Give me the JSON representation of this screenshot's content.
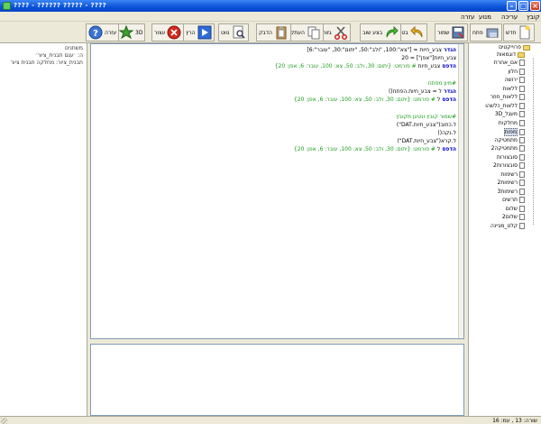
{
  "window": {
    "title": "???? - ?????? ????? - ????"
  },
  "menu": [
    "קובץ",
    "עריכה",
    "מנוע",
    "עזרה"
  ],
  "toolbar": [
    {
      "label": "חדש",
      "icon": "new-file-icon"
    },
    {
      "label": "פתח",
      "icon": "open-folder-icon"
    },
    {
      "label": "שמור",
      "icon": "save-icon"
    },
    {
      "label": "בטל",
      "icon": "undo-icon"
    },
    {
      "label": "בצע שוב",
      "icon": "redo-icon"
    },
    {
      "label": "גזור",
      "icon": "cut-icon"
    },
    {
      "label": "העתק",
      "icon": "copy-icon"
    },
    {
      "label": "הדבק",
      "icon": "paste-icon"
    },
    {
      "label": "נווט",
      "icon": "find-icon"
    },
    {
      "label": "הרץ",
      "icon": "run-icon"
    },
    {
      "label": "עצור",
      "icon": "stop-icon"
    },
    {
      "label": "3D",
      "icon": "3d-icon"
    },
    {
      "label": "עזרה",
      "icon": "help-icon"
    }
  ],
  "left_panel": [
    "משתנים",
    "ה: ׳עגם תבנית_ציור׳",
    "תבנית_ציור: מחלקה תבנית ציור"
  ],
  "code_lines": [
    [
      {
        "t": "הגדר ",
        "c": "blue"
      },
      {
        "t": "צבע_חיות = [\"צא\":100, \"ולב\":50, \"יתום\":30, \"עובר\":6]",
        "c": "black"
      }
    ],
    [
      {
        "t": "צבע_חיות[\"אפן\"] = 20",
        "c": "black"
      }
    ],
    [
      {
        "t": "הדפס ",
        "c": "blue"
      },
      {
        "t": "צבע_חיות ",
        "c": "black"
      },
      {
        "t": "# פורמט: {יתום: 30, ולב: 50, צא: 100, עובר: 6, אפן: 20}",
        "c": "green"
      }
    ],
    [],
    [
      {
        "t": "#מיון מפתח",
        "c": "green"
      }
    ],
    [
      {
        "t": "הגדר ",
        "c": "blue"
      },
      {
        "t": "ל = צבע_חיות.הפתח()",
        "c": "black"
      }
    ],
    [
      {
        "t": "הדפס ",
        "c": "blue"
      },
      {
        "t": "ל ",
        "c": "black"
      },
      {
        "t": "# פורמט: {יתום: 30, ולב: 50, צא: 100, עובר: 6, אפן: 20}",
        "c": "green"
      }
    ],
    [],
    [
      {
        "t": "#שמור קובץ ונטען מקובץ",
        "c": "green"
      }
    ],
    [
      {
        "t": "ל.כתוב(\"צבע_חיות.DAT\")",
        "c": "black"
      }
    ],
    [
      {
        "t": "ל.נקה()",
        "c": "black"
      }
    ],
    [
      {
        "t": "ל.קרא(\"צבע_חיות.DAT\")",
        "c": "black"
      }
    ],
    [
      {
        "t": "הדפס ",
        "c": "blue"
      },
      {
        "t": "ל ",
        "c": "black"
      },
      {
        "t": "# פורמט: {יתום: 30, ולב: 50, צא: 100, עובר: 6, אפן: 20}",
        "c": "green"
      }
    ]
  ],
  "tree": {
    "root": "פרוייקטים",
    "folder": "דוגמאות",
    "files": [
      "אם_אחרת",
      "חלון",
      "ירושה",
      "ללאות",
      "ללאות_חוזר",
      "ללאות_כלשהו",
      "מעגל_3D",
      "מחלקות",
      "מפות",
      "מתמטיקה",
      "מתמטיקה2",
      "סובצורות",
      "סובצורות2",
      "רשימות",
      "רשימות2",
      "רשימות3",
      "תרשים",
      "שלום",
      "שלום2",
      "קלט_מגיינה"
    ],
    "selected_index": 8
  },
  "status": "שורה: 13 , עמ: 16"
}
